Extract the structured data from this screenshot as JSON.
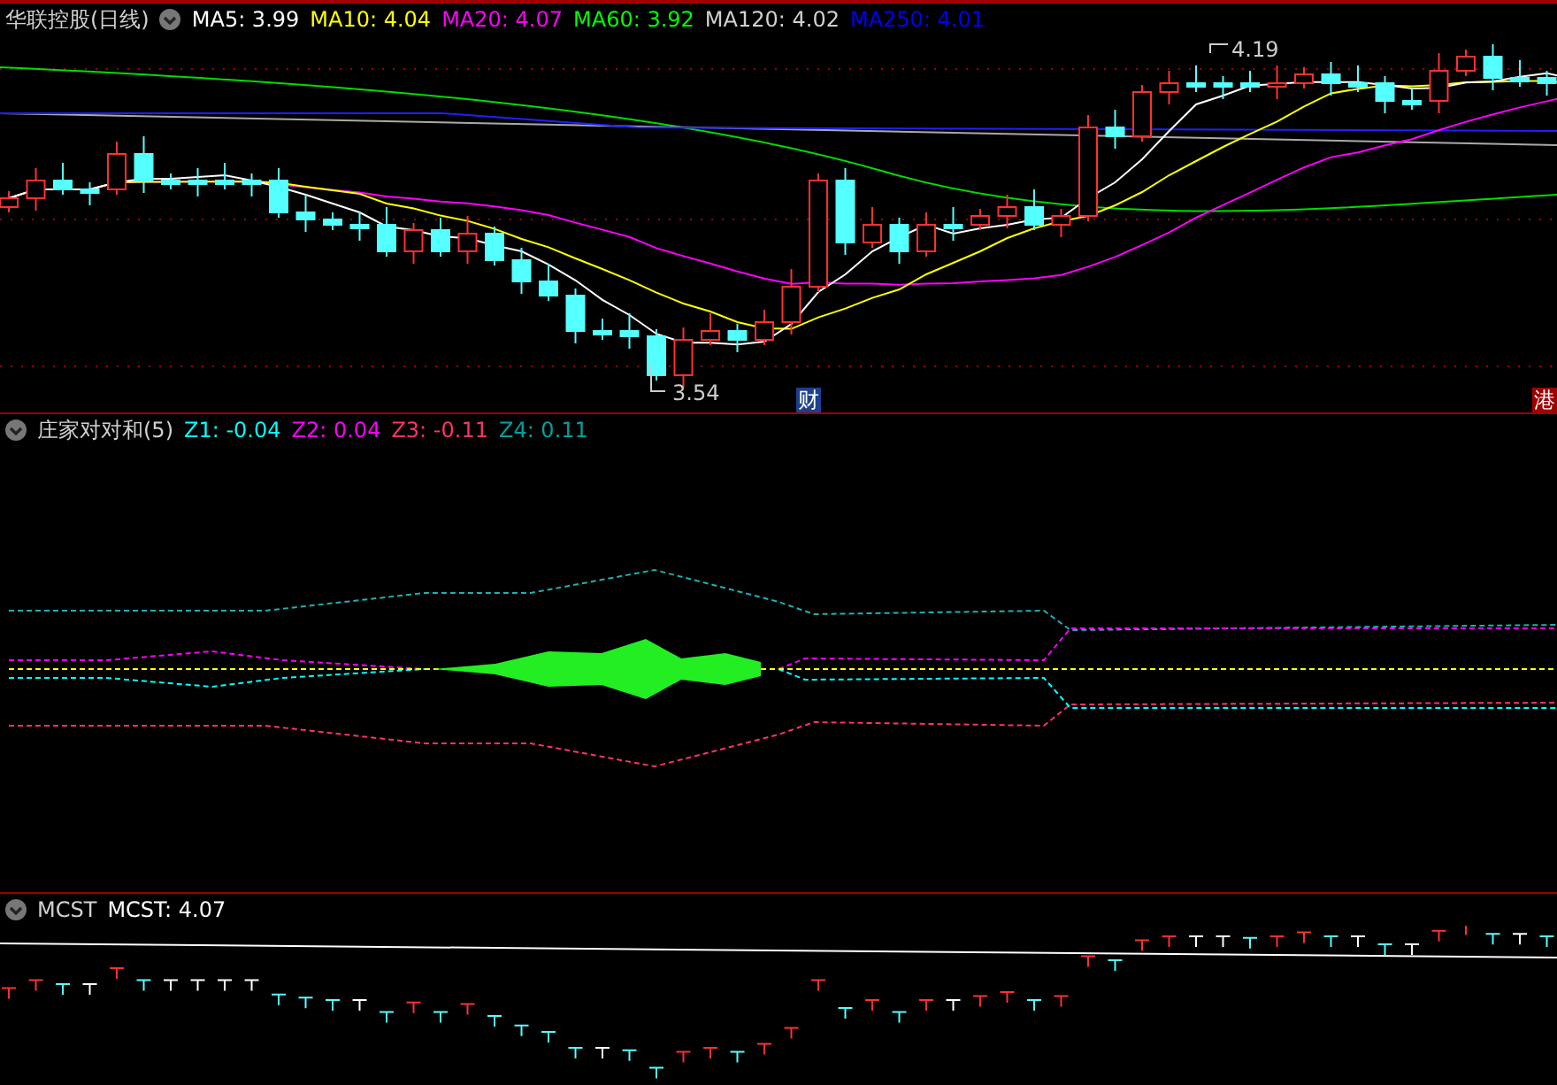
{
  "panels": [
    {
      "kind": "price",
      "title": "华联控股(日线)",
      "indicators": [
        {
          "label": "MA5: 3.99",
          "color": "#ffffff"
        },
        {
          "label": "MA10: 4.04",
          "color": "#ffff00"
        },
        {
          "label": "MA20: 4.07",
          "color": "#ff00ff"
        },
        {
          "label": "MA60: 3.92",
          "color": "#00ff00"
        },
        {
          "label": "MA120: 4.02",
          "color": "#d0d0d0"
        },
        {
          "label": "MA250: 4.01",
          "color": "#0000ff"
        }
      ],
      "markers": [
        {
          "kind": "high",
          "text": "4.19"
        },
        {
          "kind": "low",
          "text": "3.54"
        }
      ],
      "badges": [
        {
          "kind": "mid",
          "text": "财",
          "color": "#1c3f8f"
        },
        {
          "kind": "edge",
          "text": "港",
          "color": "#a00000"
        }
      ]
    },
    {
      "kind": "oscillator",
      "title": "庄家对对和(5)",
      "indicators": [
        {
          "label": "Z1: -0.04",
          "color": "#00ffff"
        },
        {
          "label": "Z2: 0.04",
          "color": "#ff00ff"
        },
        {
          "label": "Z3: -0.11",
          "color": "#ff3366"
        },
        {
          "label": "Z4: 0.11",
          "color": "#00a0a0"
        }
      ]
    },
    {
      "kind": "cost",
      "title": "MCST",
      "indicators": [
        {
          "label": "MCST: 4.07",
          "color": "#ffffff"
        }
      ]
    }
  ]
}
